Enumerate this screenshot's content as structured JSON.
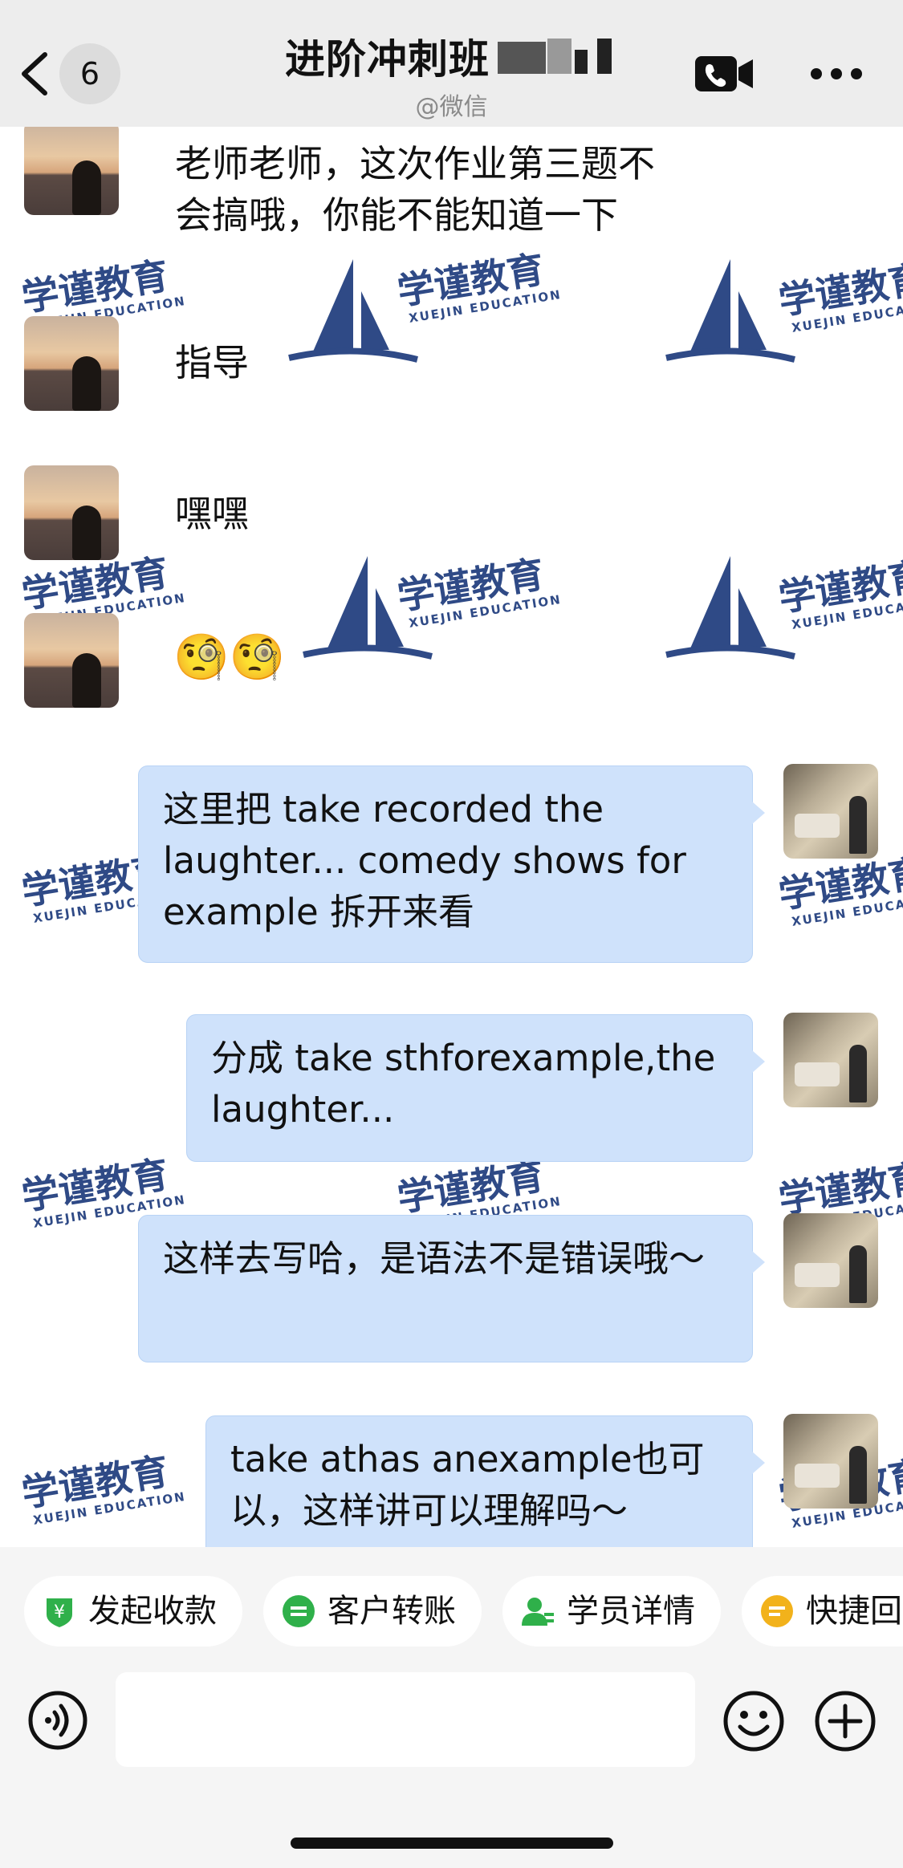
{
  "header": {
    "unread_count": "6",
    "title": "进阶冲刺班",
    "subtitle": "@微信"
  },
  "watermark": {
    "brand": "学谨教育",
    "brand_en": "XUEJIN EDUCATION",
    "color": "#2f4a86"
  },
  "messages": [
    {
      "side": "left",
      "text": "老师老师，这次作业第三题不\n会搞哦，你能不能知道一下"
    },
    {
      "side": "left",
      "text": "指导"
    },
    {
      "side": "left",
      "text": "嘿嘿"
    },
    {
      "side": "left",
      "text": "🧐🧐"
    },
    {
      "side": "right",
      "text": "这里把 take recorded the laughter... comedy shows for example 拆开来看"
    },
    {
      "side": "right",
      "text": "分成 take sthforexample,the laughter..."
    },
    {
      "side": "right",
      "text": "这样去写哈，是语法不是错误哦～"
    },
    {
      "side": "right",
      "text": "take athas anexample也可以，这样讲可以理解吗～"
    }
  ],
  "quick_actions": [
    {
      "label": "发起收款",
      "icon": "payment-icon",
      "color": "#2fb04a"
    },
    {
      "label": "客户转账",
      "icon": "transfer-icon",
      "color": "#2fb04a"
    },
    {
      "label": "学员详情",
      "icon": "student-icon",
      "color": "#2fb04a"
    },
    {
      "label": "快捷回",
      "icon": "quick-reply-icon",
      "color": "#f2b21b"
    }
  ],
  "input": {
    "placeholder": ""
  },
  "colors": {
    "bubble": "#cfe2fb",
    "header_bg": "#ededed",
    "bar_bg": "#f5f5f5"
  }
}
